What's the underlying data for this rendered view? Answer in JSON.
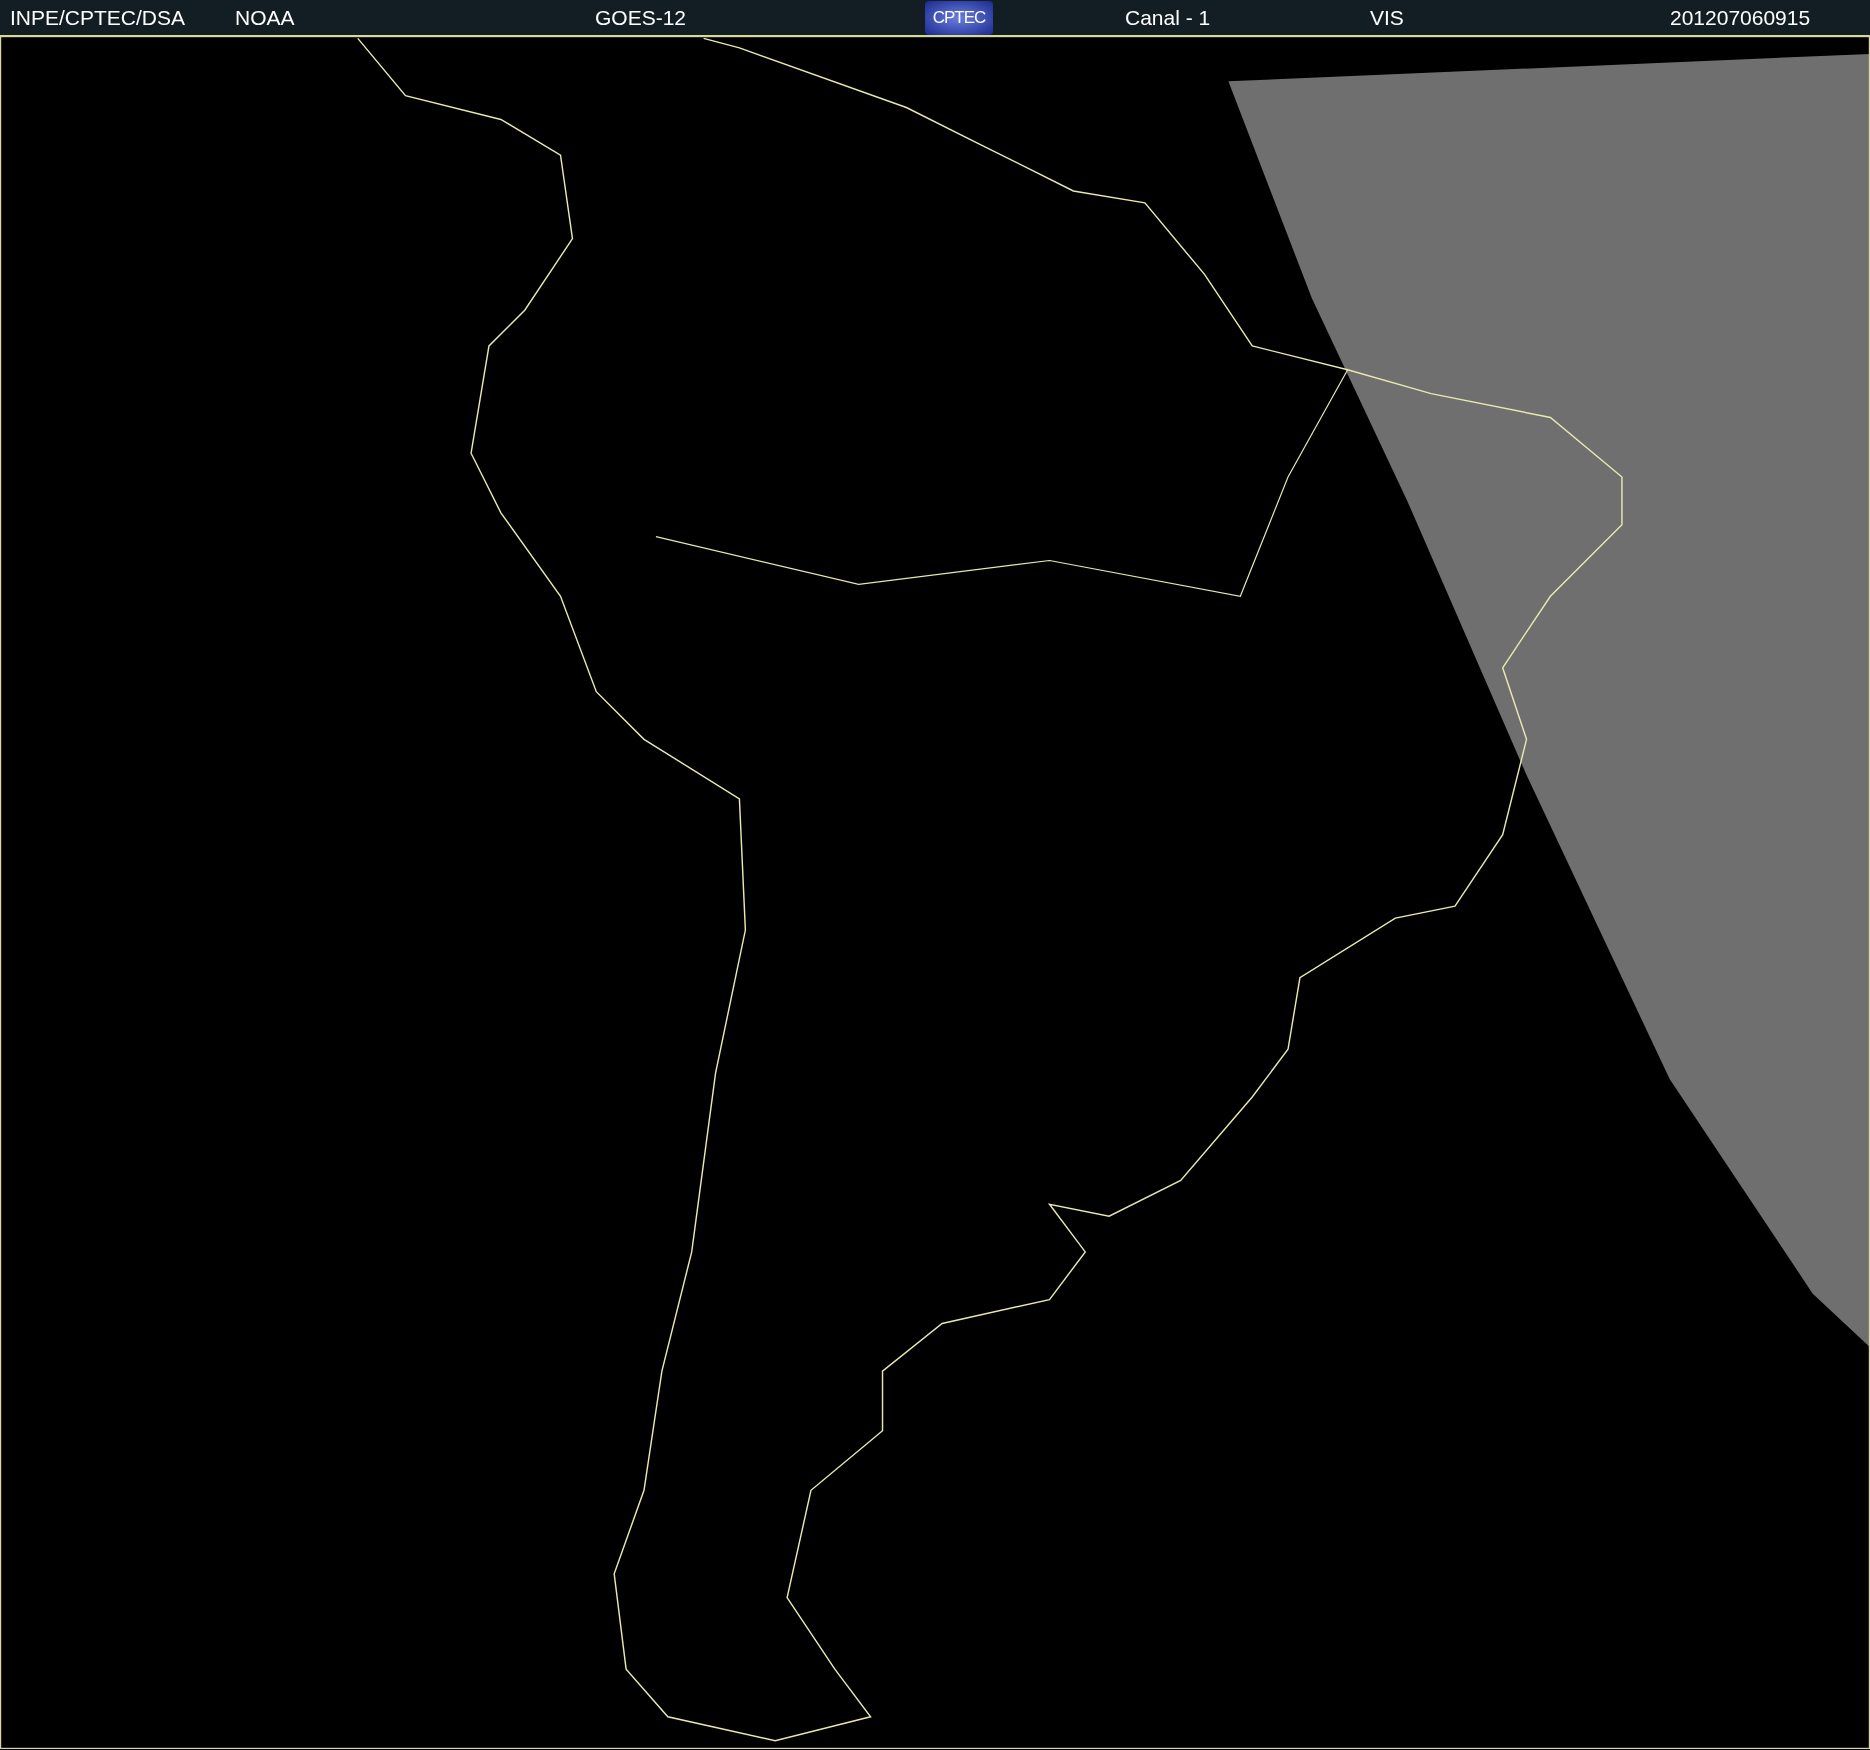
{
  "header": {
    "items": [
      {
        "kind": "text",
        "text": "INPE/CPTEC/DSA"
      },
      {
        "kind": "text",
        "text": "NOAA"
      },
      {
        "kind": "text",
        "text": "GOES-12"
      },
      {
        "kind": "logo",
        "text": "CPTEC"
      },
      {
        "kind": "text",
        "text": "Canal - 1"
      },
      {
        "kind": "text",
        "text": "VIS"
      },
      {
        "kind": "text",
        "text": "201207060915"
      }
    ]
  }
}
